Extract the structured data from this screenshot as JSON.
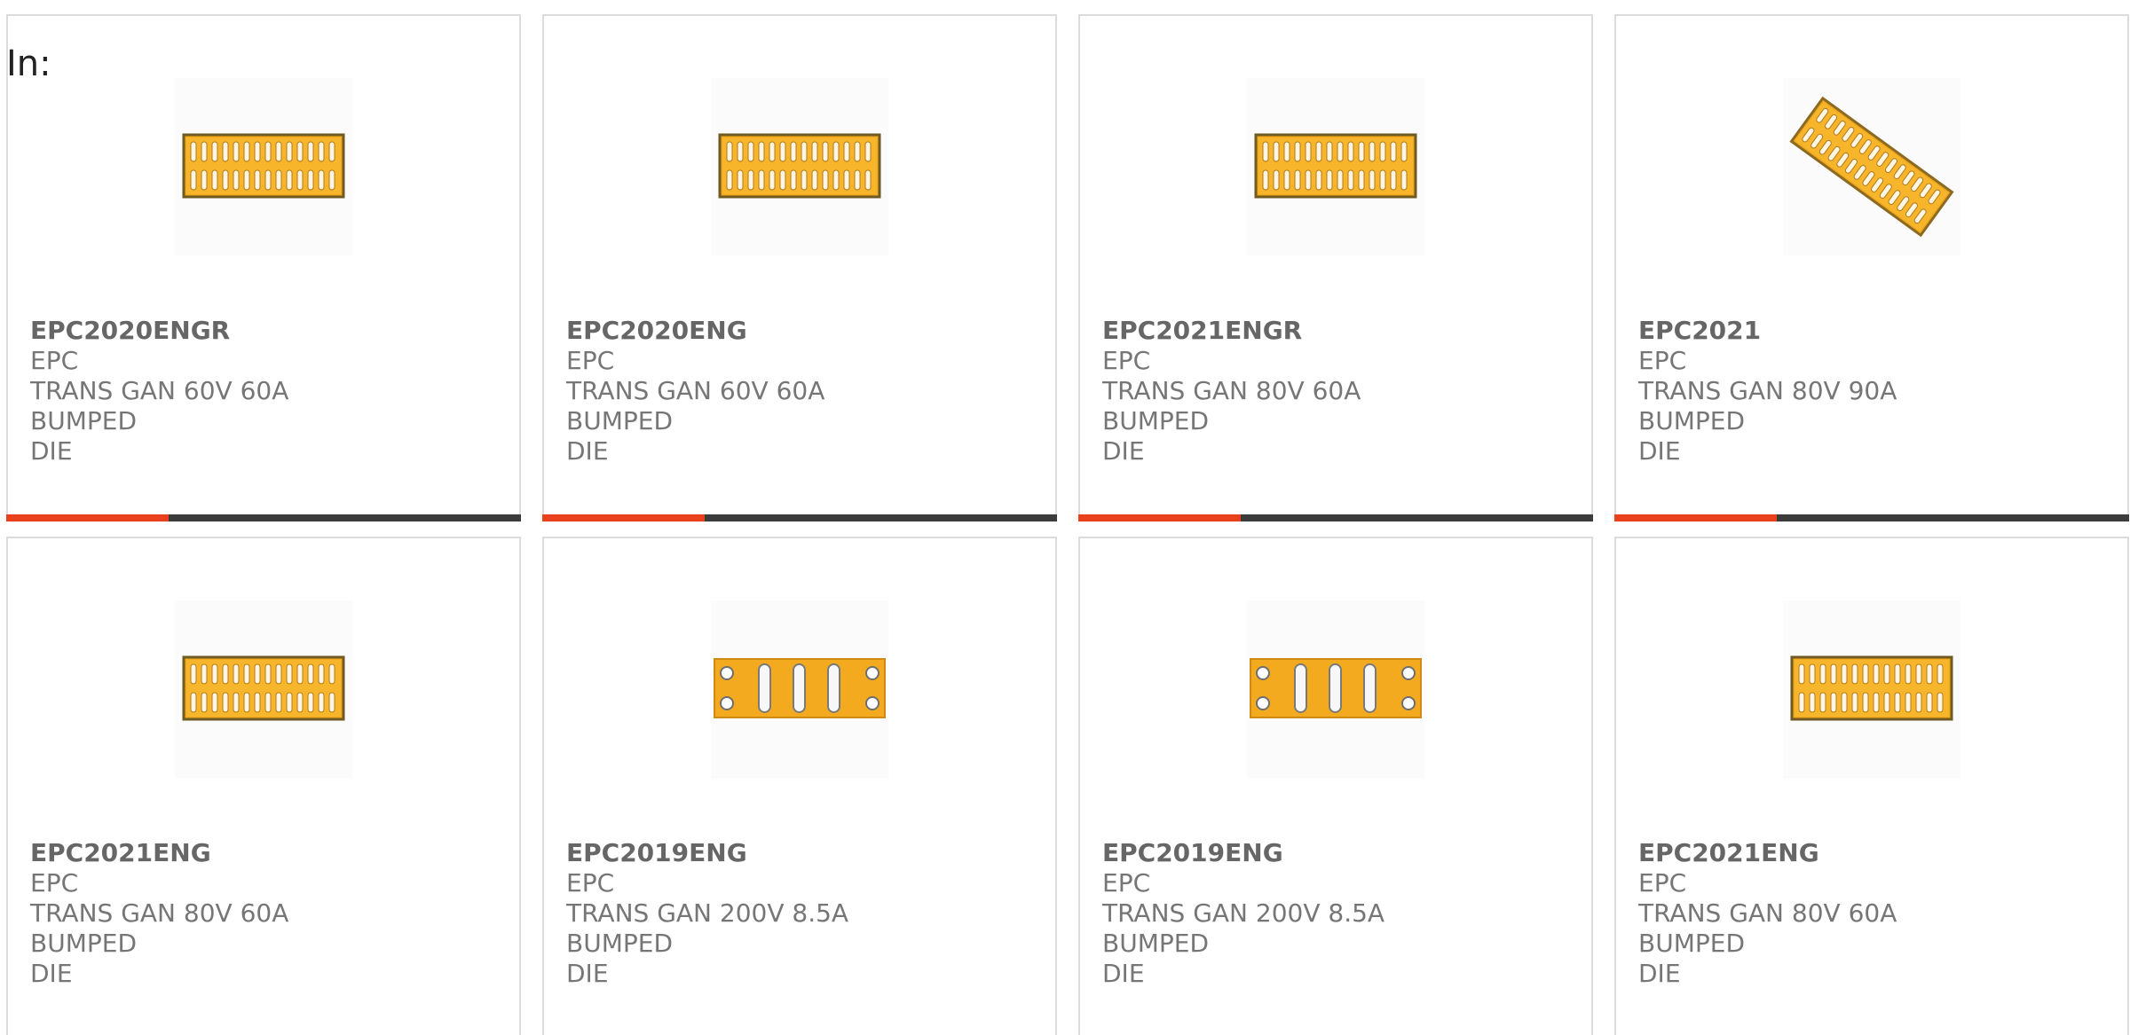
{
  "filter_label": "In:",
  "colors": {
    "accent": "#e8411c",
    "bar_track": "#3c3c3c",
    "card_border": "#dcdcdc",
    "text_muted": "#767676"
  },
  "products": [
    {
      "part_number": "EPC2020ENGR",
      "manufacturer": "EPC",
      "description_line1": "TRANS GAN 60V 60A BUMPED",
      "description_line2": "DIE",
      "image_icon": "bumped-die-grid-icon"
    },
    {
      "part_number": "EPC2020ENG",
      "manufacturer": "EPC",
      "description_line1": "TRANS GAN 60V 60A BUMPED",
      "description_line2": "DIE",
      "image_icon": "bumped-die-grid-icon"
    },
    {
      "part_number": "EPC2021ENGR",
      "manufacturer": "EPC",
      "description_line1": "TRANS GAN 80V 60A BUMPED",
      "description_line2": "DIE",
      "image_icon": "bumped-die-grid-icon"
    },
    {
      "part_number": "EPC2021",
      "manufacturer": "EPC",
      "description_line1": "TRANS GAN 80V 90A BUMPED",
      "description_line2": "DIE",
      "image_icon": "bumped-die-rotated-icon"
    },
    {
      "part_number": "EPC2021ENG",
      "manufacturer": "EPC",
      "description_line1": "TRANS GAN 80V 60A BUMPED",
      "description_line2": "DIE",
      "image_icon": "bumped-die-grid-icon"
    },
    {
      "part_number": "EPC2019ENG",
      "manufacturer": "EPC",
      "description_line1": "TRANS GAN 200V 8.5A BUMPED",
      "description_line2": "DIE",
      "image_icon": "bumped-die-small-icon"
    },
    {
      "part_number": "EPC2019ENG",
      "manufacturer": "EPC",
      "description_line1": "TRANS GAN 200V 8.5A BUMPED",
      "description_line2": "DIE",
      "image_icon": "bumped-die-small-icon"
    },
    {
      "part_number": "EPC2021ENG",
      "manufacturer": "EPC",
      "description_line1": "TRANS GAN 80V 60A BUMPED",
      "description_line2": "DIE",
      "image_icon": "bumped-die-grid-icon"
    }
  ]
}
